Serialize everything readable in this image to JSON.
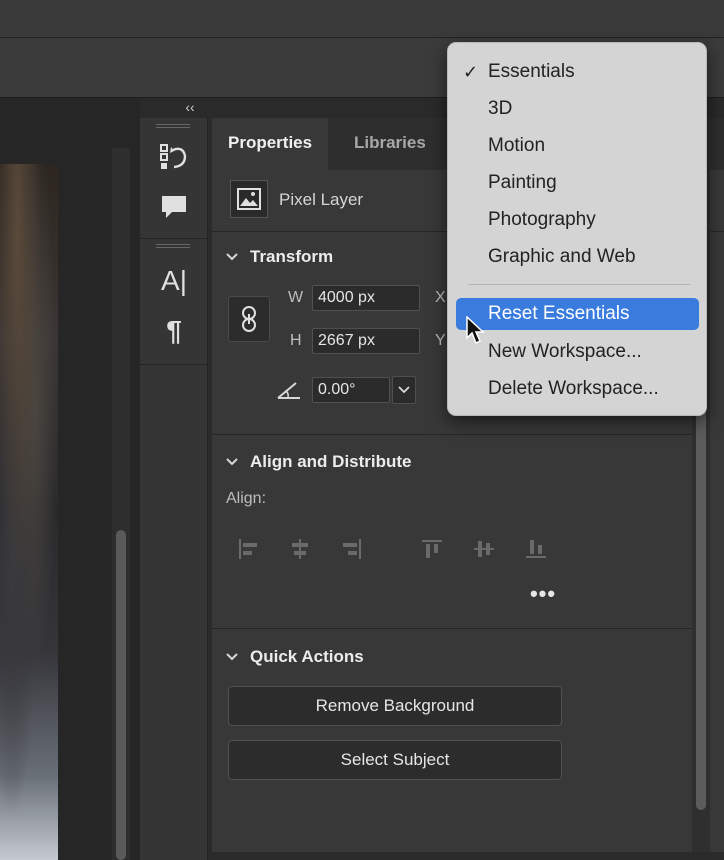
{
  "panel": {
    "tabs": [
      {
        "label": "Properties"
      },
      {
        "label": "Libraries"
      }
    ],
    "layer_type": "Pixel Layer",
    "transform": {
      "title": "Transform",
      "w_label": "W",
      "w_value": "4000 px",
      "h_label": "H",
      "h_value": "2667 px",
      "x_label": "X",
      "y_label": "Y",
      "angle_value": "0.00°"
    },
    "align": {
      "title": "Align and Distribute",
      "label": "Align:",
      "more": "•••"
    },
    "quick_actions": {
      "title": "Quick Actions",
      "buttons": [
        {
          "label": "Remove Background"
        },
        {
          "label": "Select Subject"
        }
      ]
    }
  },
  "collapse": {
    "label": "‹‹"
  },
  "workspace_menu": {
    "items": [
      {
        "label": "Essentials",
        "checked": true
      },
      {
        "label": "3D"
      },
      {
        "label": "Motion"
      },
      {
        "label": "Painting"
      },
      {
        "label": "Photography"
      },
      {
        "label": "Graphic and Web"
      },
      {
        "label": "Reset Essentials",
        "highlighted": true
      },
      {
        "label": "New Workspace..."
      },
      {
        "label": "Delete Workspace..."
      }
    ],
    "check_mark": "✓",
    "highlight_color": "#3a7bde"
  },
  "dock": {
    "icons": [
      "history-icon",
      "comment-icon",
      "character-icon",
      "paragraph-icon"
    ],
    "character_glyph": "A|",
    "paragraph_glyph": "¶"
  }
}
